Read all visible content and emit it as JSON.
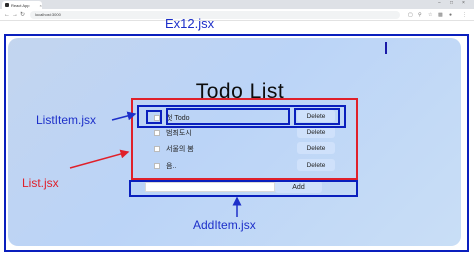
{
  "browser": {
    "tab_title": "React App",
    "tab_close": "×",
    "url": "localhost:3000",
    "window_controls": [
      "−",
      "□",
      "×"
    ],
    "nav_icons": [
      "back-icon",
      "forward-icon",
      "reload-icon"
    ],
    "toolbar_icons": [
      "translate-icon",
      "zoom-icon",
      "star-icon",
      "extension-icon",
      "profile-icon",
      "menu-icon"
    ]
  },
  "annotations": {
    "ex12": "Ex12.jsx",
    "listitem": "ListItem.jsx",
    "list": "List.jsx",
    "additem": "AddItem.jsx",
    "colors": {
      "blue": "#0a1fbd",
      "red": "#e0202a"
    }
  },
  "app": {
    "title": "Todo List",
    "items": [
      {
        "text": "첫 Todo",
        "delete_label": "Delete"
      },
      {
        "text": "범죄도시",
        "delete_label": "Delete"
      },
      {
        "text": "서울의 봄",
        "delete_label": "Delete"
      },
      {
        "text": "음..",
        "delete_label": "Delete"
      }
    ],
    "add_input_value": "",
    "add_label": "Add"
  },
  "colors": {
    "app_bg": "#bbd4f7",
    "button_bg": "#cfe1fb"
  }
}
